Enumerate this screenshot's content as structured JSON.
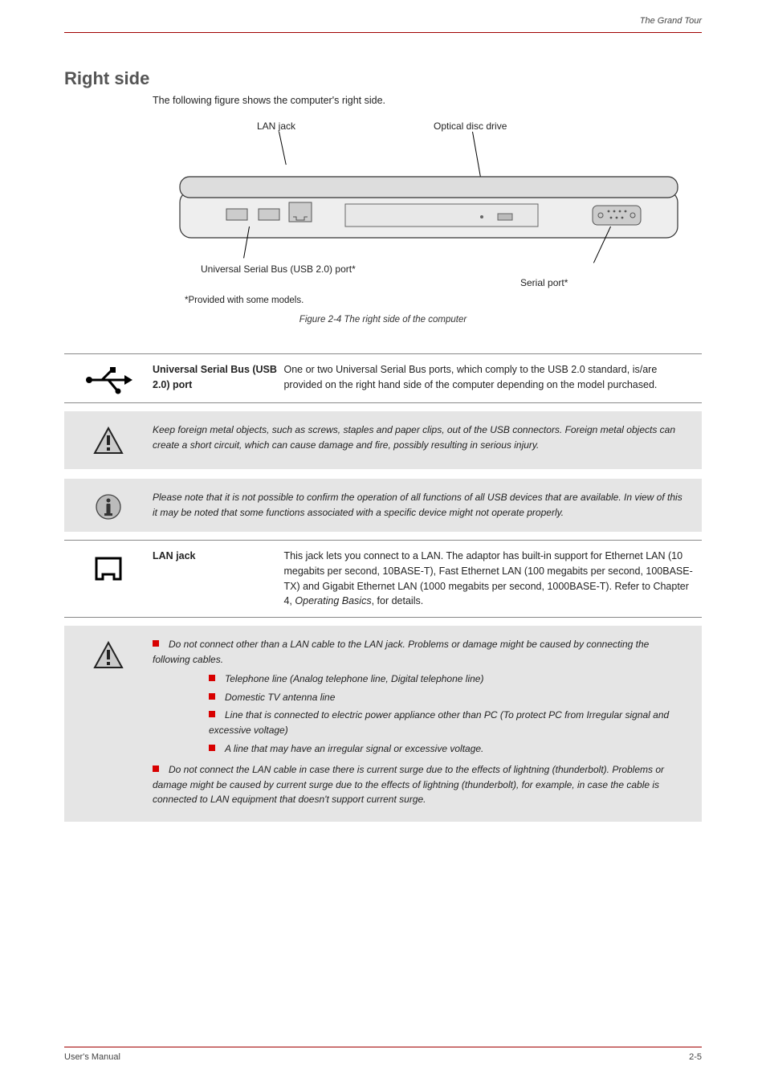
{
  "header": {
    "right": "The Grand Tour"
  },
  "section_title": "Right side",
  "intro": "The following figure shows the computer's right side.",
  "diagram": {
    "labels": {
      "lan": "LAN jack",
      "odd": "Optical disc drive",
      "usb": "Universal Serial Bus (USB 2.0) port*",
      "serial": "Serial port*"
    },
    "footnote": "*Provided with some models.",
    "caption": "Figure 2-4 The right side of the computer"
  },
  "usb_row": {
    "label": "Universal Serial Bus (USB 2.0) port",
    "desc": "One or two Universal Serial Bus ports, which comply to the USB 2.0 standard, is/are provided on the right hand side of the computer depending on the model purchased."
  },
  "warn1": "Keep foreign metal objects, such as screws, staples and paper clips, out of the USB connectors. Foreign metal objects can create a short circuit, which can cause damage and fire, possibly resulting in serious injury.",
  "info1": "Please note that it is not possible to confirm the operation of all functions of all USB devices that are available. In view of this it may be noted that some functions associated with a specific device might not operate properly.",
  "lan_row": {
    "label": "LAN jack",
    "desc": "This jack lets you connect to a LAN. The adaptor has built-in support for Ethernet LAN (10 megabits per second, 10BASE-T), Fast Ethernet LAN (100 megabits per second, 100BASE-TX) and Gigabit Ethernet LAN (1000 megabits per second, 1000BASE-T). Refer to Chapter 4, Operating Basics, for details."
  },
  "chapter_ref": "Operating Basics",
  "warn2": {
    "lead": "Do not connect other than a LAN cable to the LAN jack. Problems or damage might be caused by connecting the following cables.",
    "items": [
      "Telephone line (Analog telephone line, Digital telephone line)",
      "Domestic TV antenna line",
      "Line that is connected to electric power appliance other than PC (To protect PC from Irregular signal and excessive voltage)",
      "A line that may have an irregular signal or excessive voltage."
    ],
    "tail": "Do not connect the LAN cable in case there is current surge due to the effects of lightning (thunderbolt). Problems or damage might be caused by current surge due to the effects of lightning (thunderbolt), for example, in case the cable is connected to LAN equipment that doesn't support current surge."
  },
  "footer": {
    "left": "User's Manual",
    "right": "2-5"
  }
}
